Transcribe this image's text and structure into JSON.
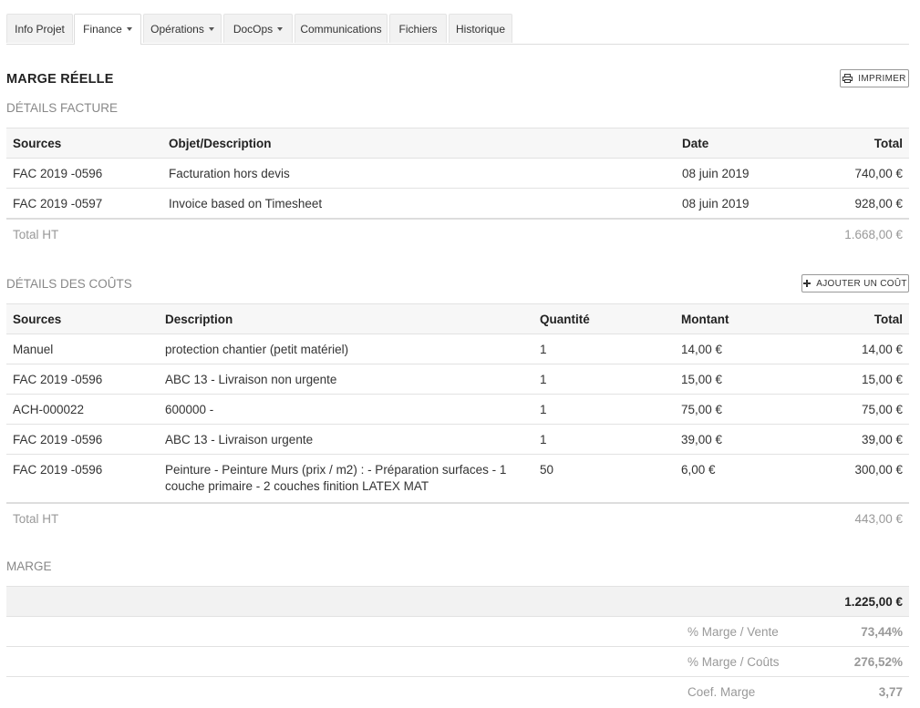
{
  "tabs": [
    {
      "label": "Info Projet",
      "dropdown": false,
      "active": false
    },
    {
      "label": "Finance",
      "dropdown": true,
      "active": true
    },
    {
      "label": "Opérations",
      "dropdown": true,
      "active": false
    },
    {
      "label": "DocOps",
      "dropdown": true,
      "active": false
    },
    {
      "label": "Communications",
      "dropdown": false,
      "active": false
    },
    {
      "label": "Fichiers",
      "dropdown": false,
      "active": false
    },
    {
      "label": "Historique",
      "dropdown": false,
      "active": false
    }
  ],
  "page_title": "MARGE RÉELLE",
  "print_button": {
    "label": "IMPRIMER",
    "icon": "printer-icon"
  },
  "invoice": {
    "title": "DÉTAILS FACTURE",
    "headers": [
      "Sources",
      "Objet/Description",
      "Date",
      "Total"
    ],
    "rows": [
      {
        "source": "FAC 2019 -0596",
        "description": "Facturation hors devis",
        "date": "08 juin 2019",
        "total": "740,00 €"
      },
      {
        "source": "FAC 2019 -0597",
        "description": "Invoice based on Timesheet",
        "date": "08 juin 2019",
        "total": "928,00 €"
      }
    ],
    "total_label": "Total HT",
    "total_value": "1.668,00 €"
  },
  "costs": {
    "title": "DÉTAILS DES COÛTS",
    "add_button": {
      "label": "AJOUTER UN COÛT",
      "icon": "plus-icon"
    },
    "headers": [
      "Sources",
      "Description",
      "Quantité",
      "Montant",
      "Total"
    ],
    "rows": [
      {
        "source": "Manuel",
        "description": "protection chantier (petit matériel)",
        "qty": "1",
        "amount": "14,00 €",
        "total": "14,00 €"
      },
      {
        "source": "FAC 2019 -0596",
        "description": "ABC 13 - Livraison non urgente",
        "qty": "1",
        "amount": "15,00 €",
        "total": "15,00 €"
      },
      {
        "source": "ACH-000022",
        "description": "600000 -",
        "qty": "1",
        "amount": "75,00 €",
        "total": "75,00 €"
      },
      {
        "source": "FAC 2019 -0596",
        "description": "ABC 13 - Livraison urgente",
        "qty": "1",
        "amount": "39,00 €",
        "total": "39,00 €"
      },
      {
        "source": "FAC 2019 -0596",
        "description": "Peinture - Peinture Murs (prix / m2) : - Préparation surfaces - 1 couche primaire - 2 couches finition LATEX MAT",
        "qty": "50",
        "amount": "6,00 €",
        "total": "300,00 €"
      }
    ],
    "total_label": "Total HT",
    "total_value": "443,00 €"
  },
  "marge": {
    "title": "MARGE",
    "value": "1.225,00 €",
    "rows": [
      {
        "label": "% Marge / Vente",
        "value": "73,44%"
      },
      {
        "label": "% Marge / Coûts",
        "value": "276,52%"
      },
      {
        "label": "Coef. Marge",
        "value": "3,77"
      }
    ]
  }
}
